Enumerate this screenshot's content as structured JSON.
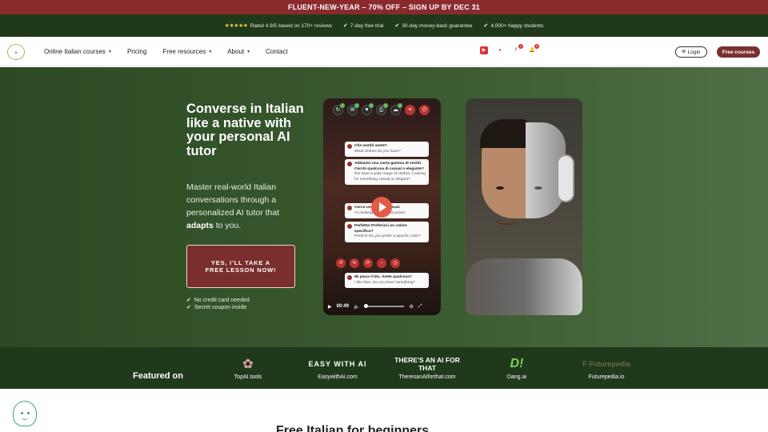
{
  "promo": {
    "text": "FLUENT-NEW-YEAR – 70% OFF – SIGN UP BY DEC 31"
  },
  "trust": {
    "stars": "★★★★★",
    "rating": "Rated 4.9/5 based on 170+ reviews",
    "trial": "7-day free trial",
    "guarantee": "30-day money-back guarantee",
    "students": "4,000+ happy students"
  },
  "nav": {
    "items": [
      {
        "label": "Online Italian courses",
        "dropdown": true
      },
      {
        "label": "Pricing",
        "dropdown": false
      },
      {
        "label": "Free resources",
        "dropdown": true
      },
      {
        "label": "About",
        "dropdown": true
      },
      {
        "label": "Contact",
        "dropdown": false
      }
    ],
    "login": "Login",
    "free_courses": "Free courses",
    "badge_count_1": "1",
    "badge_count_2": "0"
  },
  "hero": {
    "headline": "Converse in Italian like a native with your personal AI tutor",
    "sub_before": "Master real-world Italian conversations through a personalized AI tutor that ",
    "sub_bold": "adapts",
    "sub_after": " to you.",
    "cta": "YES, I'LL TAKE A FREE LESSON NOW!",
    "perk1": "No credit card needed",
    "perk2": "Secret coupon inside"
  },
  "demo": {
    "bubbles": [
      {
        "it": "Che vestiti avete?",
        "en": "What clothes do you have?"
      },
      {
        "it": "Abbiamo una vasta gamma di vestiti. Cerchi qualcosa di casual o elegante?",
        "en": "We have a wide range of clothes. Looking for something casual or elegant?"
      },
      {
        "it": "Cerco una giacca casual.",
        "en": "I'm looking for a casual jacket."
      },
      {
        "it": "Perfetto! Preferisci un colore specifico?",
        "en": "Perfect! Do you prefer a specific color?"
      },
      {
        "it": "Mi piace il blu. Avete qualcosa?",
        "en": "I like blue. Do you have something?"
      }
    ],
    "video_time": "00:49"
  },
  "featured": {
    "title": "Featured on",
    "sites": [
      {
        "logo": "✿",
        "name": "TopAI.tools"
      },
      {
        "logo": "EASY WITH AI",
        "name": "EasywithAi.com"
      },
      {
        "logo": "THERE'S AN AI FOR THAT",
        "name": "TheresanAIforthat.com"
      },
      {
        "logo": "D!",
        "name": "Dang.ai"
      },
      {
        "logo": "F Futurepedia",
        "name": "Futurepedia.io"
      }
    ]
  },
  "bottom": {
    "heading": "Free Italian for beginners"
  }
}
